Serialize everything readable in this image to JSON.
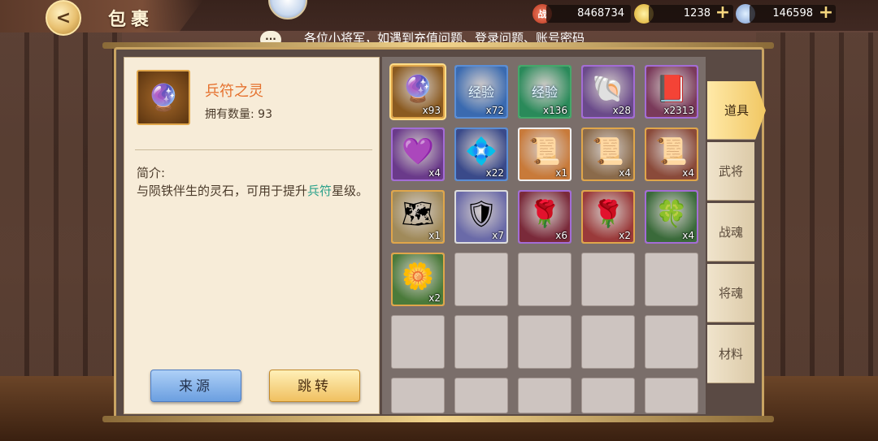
{
  "header": {
    "title": "包裹",
    "back_label": "<",
    "resources": [
      {
        "name": "battle-power",
        "icon": "战",
        "value": "8468734"
      },
      {
        "name": "gold-ingot",
        "icon": "",
        "value": "1238"
      },
      {
        "name": "coin",
        "icon": "",
        "value": "146598"
      }
    ],
    "plus": "+"
  },
  "marquee": {
    "icon": "···",
    "text": "各位小将军，如遇到充值问题、登录问题、账号密码"
  },
  "detail": {
    "name": "兵符之灵",
    "count_label": "拥有数量: 93",
    "intro_label": "简介:",
    "intro_pre": "与陨铁伴生的灵石，可用于提升",
    "intro_highlight": "兵符",
    "intro_post": "星级。",
    "source_button": "来源",
    "jump_button": "跳转"
  },
  "items": [
    {
      "glyph": "🔮",
      "count": "x93",
      "quality": "#e0a64a",
      "bg": "#8a5a20",
      "selected": true
    },
    {
      "glyph": "经验",
      "count": "x72",
      "quality": "#5a8ed6",
      "bg": "#3a6ab0",
      "text_glyph": true
    },
    {
      "glyph": "经验",
      "count": "x136",
      "quality": "#45a86a",
      "bg": "#2a8a5a",
      "text_glyph": true
    },
    {
      "glyph": "🐚",
      "count": "x28",
      "quality": "#a36cd6",
      "bg": "#6a4a8a"
    },
    {
      "glyph": "📕",
      "count": "x2313",
      "quality": "#a36cd6",
      "bg": "#7a3a5a"
    },
    {
      "glyph": "💜",
      "count": "x4",
      "quality": "#a36cd6",
      "bg": "#6a3a8a"
    },
    {
      "glyph": "💠",
      "count": "x22",
      "quality": "#5a8ed6",
      "bg": "#3a4a8a"
    },
    {
      "glyph": "📜",
      "count": "x1",
      "quality": "#f0f0f0",
      "bg": "#c87a3a"
    },
    {
      "glyph": "📜",
      "count": "x4",
      "quality": "#e0a64a",
      "bg": "#8a6a4a"
    },
    {
      "glyph": "📜",
      "count": "x4",
      "quality": "#e0a64a",
      "bg": "#8a4a3a"
    },
    {
      "glyph": "🗺",
      "count": "x1",
      "quality": "#e0a64a",
      "bg": "#a08a5a"
    },
    {
      "glyph": "🛡",
      "count": "x7",
      "quality": "#dcdcdc",
      "bg": "#6a6aa8"
    },
    {
      "glyph": "🌹",
      "count": "x6",
      "quality": "#a36cd6",
      "bg": "#7a2a3a"
    },
    {
      "glyph": "🌹",
      "count": "x2",
      "quality": "#e0a64a",
      "bg": "#9a3a3a"
    },
    {
      "glyph": "🍀",
      "count": "x4",
      "quality": "#a36cd6",
      "bg": "#3a6a3a"
    },
    {
      "glyph": "🌼",
      "count": "x2",
      "quality": "#e0a64a",
      "bg": "#4a7a3a"
    }
  ],
  "tabs": [
    {
      "label": "道具",
      "active": true
    },
    {
      "label": "武将",
      "active": false
    },
    {
      "label": "战魂",
      "active": false
    },
    {
      "label": "将魂",
      "active": false
    },
    {
      "label": "材料",
      "active": false
    }
  ]
}
